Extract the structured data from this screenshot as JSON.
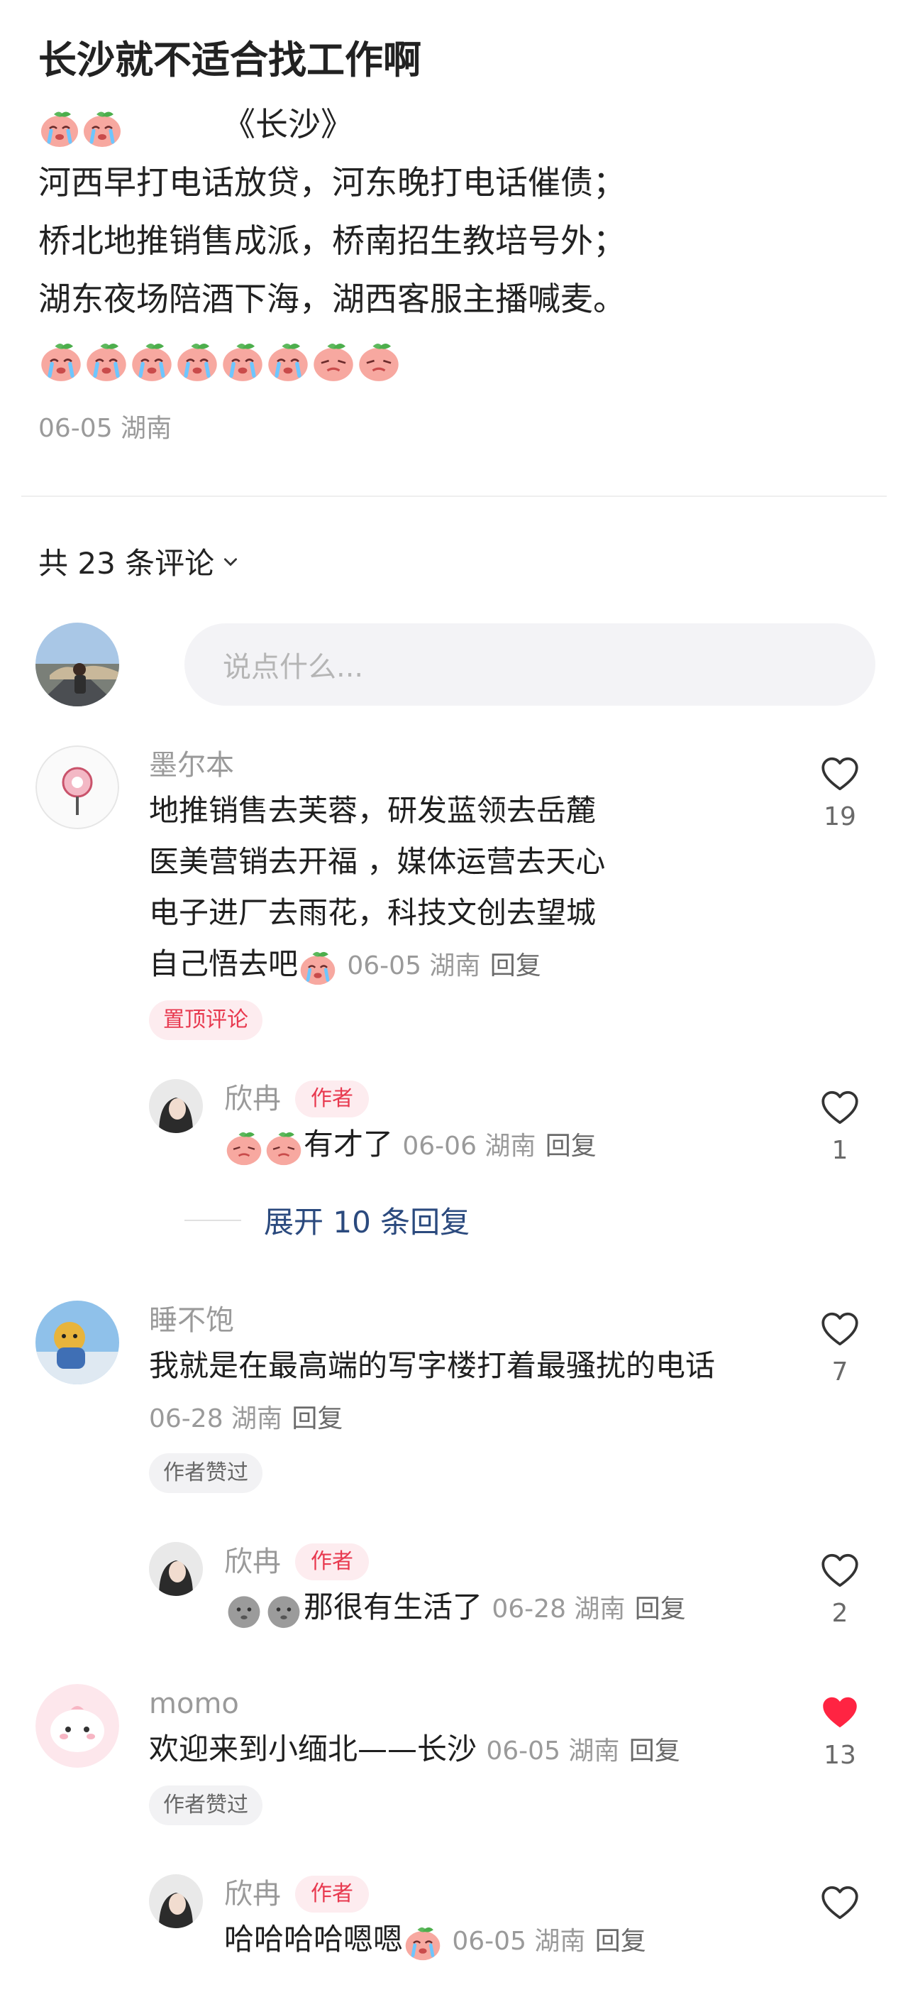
{
  "post": {
    "title": "长沙就不适合找工作啊",
    "line0": "《长沙》",
    "line1": "河西早打电话放贷，河东晚打电话催债；",
    "line2": "桥北地推销售成派，桥南招生教培号外；",
    "line3": "湖东夜场陪酒下海，湖西客服主播喊麦。",
    "meta": "06-05 湖南"
  },
  "comments_header": {
    "label": "共 23 条评论"
  },
  "composer": {
    "placeholder": "说点什么..."
  },
  "comments": [
    {
      "user": "墨尔本",
      "lines": [
        "地推销售去芙蓉，研发蓝领去岳麓",
        "医美营销去开福 ，媒体运营去天心",
        "电子进厂去雨花，科技文创去望城",
        "自己悟去吧"
      ],
      "meta": "06-05 湖南",
      "reply_label": "回复",
      "likes": "19",
      "badge": "置顶评论",
      "reply": {
        "user": "欣冉",
        "tag": "作者",
        "text": "有才了",
        "meta": "06-06 湖南",
        "reply_label": "回复",
        "likes": "1"
      },
      "expand": "展开 10 条回复"
    },
    {
      "user": "睡不饱",
      "text": "我就是在最高端的写字楼打着最骚扰的电话",
      "meta": "06-28 湖南",
      "reply_label": "回复",
      "likes": "7",
      "badge": "作者赞过",
      "reply": {
        "user": "欣冉",
        "tag": "作者",
        "text": "那很有生活了",
        "meta": "06-28 湖南",
        "reply_label": "回复",
        "likes": "2"
      }
    },
    {
      "user": "momo",
      "text": "欢迎来到小缅北——长沙",
      "meta": "06-05 湖南",
      "reply_label": "回复",
      "likes": "13",
      "liked": true,
      "badge": "作者赞过",
      "reply": {
        "user": "欣冉",
        "tag": "作者",
        "text": "哈哈哈哈嗯嗯",
        "meta": "06-05 湖南",
        "reply_label": "回复",
        "likes": ""
      }
    }
  ],
  "icons": {
    "emoji": "crying-peach-emoji",
    "heart": "heart-outline-icon",
    "heart_filled": "heart-filled-icon",
    "chevron": "chevron-down-icon"
  },
  "colors": {
    "like_red": "#ff2442",
    "author_tag": "#e8394f",
    "expand_link": "#2b4a7e"
  }
}
